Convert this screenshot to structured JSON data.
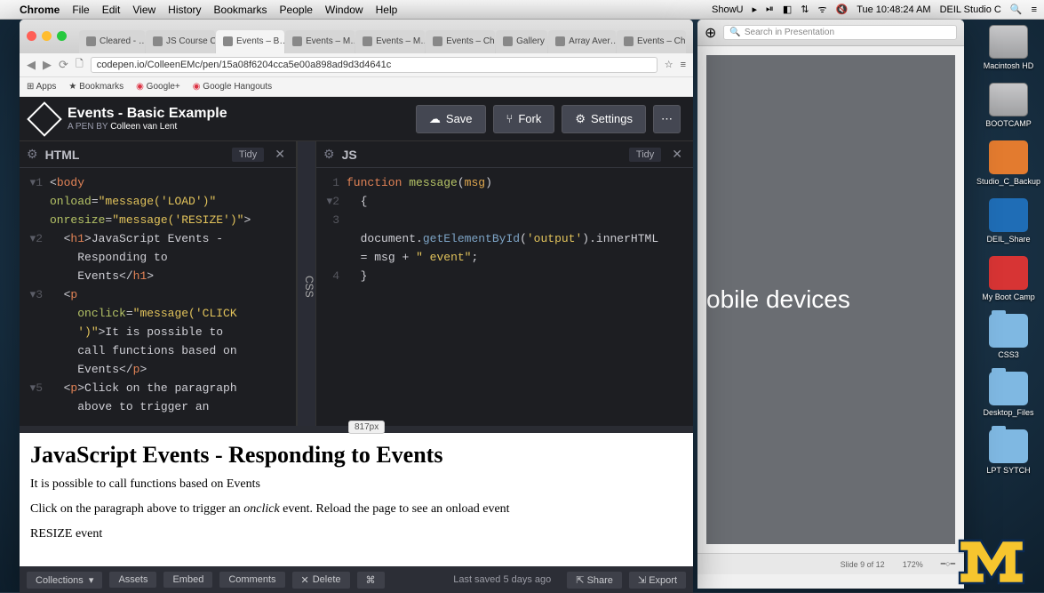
{
  "menubar": {
    "app": "Chrome",
    "items": [
      "File",
      "Edit",
      "View",
      "History",
      "Bookmarks",
      "People",
      "Window",
      "Help"
    ],
    "right": [
      "ShowU",
      "▸",
      "⏯",
      "◧",
      "⇅",
      "ᯤ",
      "🔇",
      "Tue 10:48:24 AM",
      "DEIL Studio C",
      "🔍",
      "≡"
    ]
  },
  "desktop_icons": [
    {
      "glyphClass": "drive",
      "label": "Macintosh HD"
    },
    {
      "glyphClass": "drive",
      "label": "BOOTCAMP"
    },
    {
      "glyphClass": "orange",
      "label": "Studio_C_Backup"
    },
    {
      "glyphClass": "blue",
      "label": "DEIL_Share"
    },
    {
      "glyphClass": "red",
      "label": "My Boot Camp"
    },
    {
      "glyphClass": "folder",
      "label": "CSS3"
    },
    {
      "glyphClass": "folder",
      "label": "Desktop_Files"
    },
    {
      "glyphClass": "folder",
      "label": "LPT SYTCH"
    }
  ],
  "browser": {
    "tabs": [
      {
        "label": "Cleared - …"
      },
      {
        "label": "JS Course C…"
      },
      {
        "label": "Events – B…",
        "active": true
      },
      {
        "label": "Events – M…"
      },
      {
        "label": "Events – M…"
      },
      {
        "label": "Events – Ch…"
      },
      {
        "label": "Gallery"
      },
      {
        "label": "Array Aver…"
      },
      {
        "label": "Events – Ch…"
      }
    ],
    "url": "codepen.io/ColleenEMc/pen/15a08f6204cca5e00a898ad9d3d4641c",
    "bookmarks": [
      "Apps",
      "★ Bookmarks",
      "Google+",
      "Google Hangouts"
    ]
  },
  "codepen": {
    "title": "Events - Basic Example",
    "subtitle_prefix": "A PEN BY ",
    "author": "Colleen van Lent",
    "buttons": {
      "save": "Save",
      "fork": "Fork",
      "settings": "Settings"
    },
    "panels": {
      "html": "HTML",
      "css": "CSS",
      "js": "JS",
      "tidy": "Tidy"
    },
    "divider_px": "817px",
    "footer": {
      "collections": "Collections",
      "assets": "Assets",
      "embed": "Embed",
      "comments": "Comments",
      "delete": "Delete",
      "saved": "Last saved 5 days ago",
      "share": "Share",
      "export": "Export"
    },
    "preview": {
      "h1": "JavaScript Events - Responding to Events",
      "p1": "It is possible to call functions based on Events",
      "p2a": "Click on the paragraph above to trigger an ",
      "p2em": "onclick",
      "p2b": " event. Reload the page to see an onload event",
      "p3": "RESIZE event"
    },
    "html_code": [
      {
        "n": "1",
        "arrow": "▾",
        "html": "<span class='cp'>&lt;</span><span class='ct'>body</span>"
      },
      {
        "n": "",
        "arrow": "",
        "html": "<span class='ca'>onload</span><span class='cp'>=</span><span class='cs'>\"message('LOAD')\"</span>"
      },
      {
        "n": "",
        "arrow": "",
        "html": "<span class='ca'>onresize</span><span class='cp'>=</span><span class='cs'>\"message('RESIZE')\"</span><span class='cp'>&gt;</span>"
      },
      {
        "n": "2",
        "arrow": "▾",
        "html": "  <span class='cp'>&lt;</span><span class='ct'>h1</span><span class='cp'>&gt;</span><span class='cp'>JavaScript Events -</span>"
      },
      {
        "n": "",
        "arrow": "",
        "html": "    <span class='cp'>Responding to</span>"
      },
      {
        "n": "",
        "arrow": "",
        "html": "    <span class='cp'>Events</span><span class='cp'>&lt;/</span><span class='ct'>h1</span><span class='cp'>&gt;</span>"
      },
      {
        "n": "3",
        "arrow": "▾",
        "html": "  <span class='cp'>&lt;</span><span class='ct'>p</span>"
      },
      {
        "n": "",
        "arrow": "",
        "html": "    <span class='ca'>onclick</span><span class='cp'>=</span><span class='cs'>\"message('CLICK</span>"
      },
      {
        "n": "",
        "arrow": "",
        "html": "    <span class='cs'>')\"</span><span class='cp'>&gt;It is possible to</span>"
      },
      {
        "n": "",
        "arrow": "",
        "html": "    <span class='cp'>call functions based on</span>"
      },
      {
        "n": "",
        "arrow": "",
        "html": "    <span class='cp'>Events</span><span class='cp'>&lt;/</span><span class='ct'>p</span><span class='cp'>&gt;</span>"
      },
      {
        "n": "",
        "arrow": "",
        "html": ""
      },
      {
        "n": "5",
        "arrow": "▾",
        "html": "  <span class='cp'>&lt;</span><span class='ct'>p</span><span class='cp'>&gt;Click on the paragraph</span>"
      },
      {
        "n": "",
        "arrow": "",
        "html": "    <span class='cp'>above to trigger an</span>"
      }
    ],
    "js_code": [
      {
        "n": "1",
        "arrow": "",
        "html": "<span class='ck'>function</span> <span class='cf'>message</span><span class='cb'>(</span><span class='cv'>msg</span><span class='cb'>)</span>"
      },
      {
        "n": "2",
        "arrow": "▾",
        "html": "  <span class='cb'>{</span>"
      },
      {
        "n": "3",
        "arrow": "",
        "html": ""
      },
      {
        "n": "",
        "arrow": "",
        "html": "  <span class='cp'>document</span><span class='cb'>.</span><span class='cm'>getElementById</span><span class='cb'>(</span><span class='cs'>'output'</span><span class='cb'>).</span><span class='cp'>innerHTML</span>"
      },
      {
        "n": "",
        "arrow": "",
        "html": "  <span class='cb'>=</span> <span class='cp'>msg</span> <span class='cb'>+</span> <span class='cs'>\" event\"</span><span class='cb'>;</span>"
      },
      {
        "n": "4",
        "arrow": "",
        "html": "  <span class='cb'>}</span>"
      }
    ]
  },
  "keynote": {
    "search_placeholder": "Search in Presentation",
    "slide_text": "obile devices",
    "footer_slide": "Slide 9 of 12",
    "footer_zoom": "172%"
  }
}
